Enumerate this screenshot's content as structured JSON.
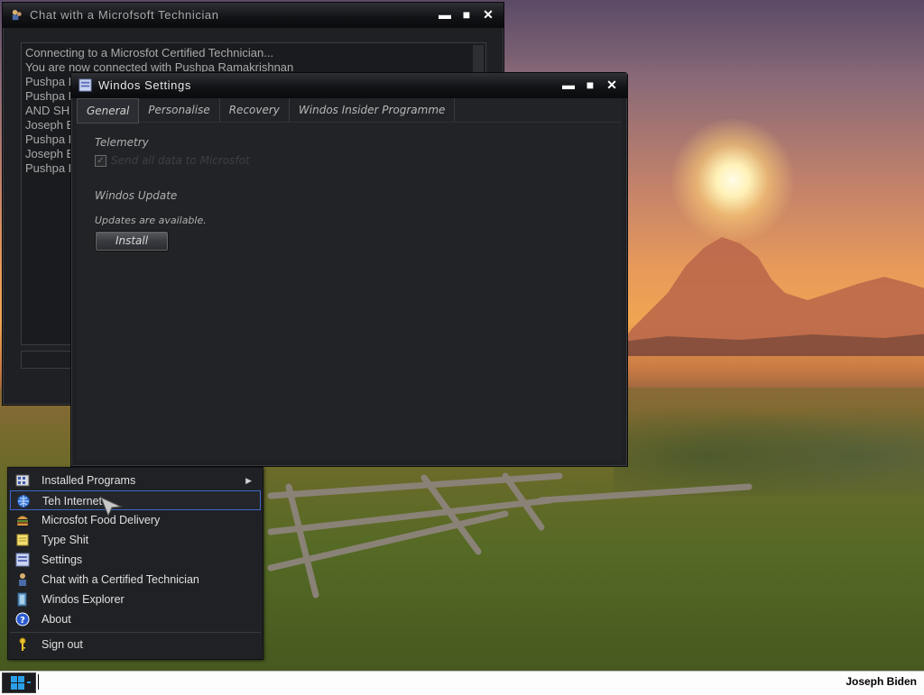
{
  "chat_window": {
    "title": "Chat with a Microfsoft Technician",
    "messages": [
      "Connecting to a Microsfot Certified Technician...",
      "You are now connected with Pushpa Ramakrishnan",
      "Pushpa R",
      "Pushpa R",
      "AND SH",
      "Joseph B",
      "Pushpa R",
      "Joseph B",
      "Pushpa R"
    ]
  },
  "settings_window": {
    "title": "Windos Settings",
    "tabs": [
      "General",
      "Personalise",
      "Recovery",
      "Windos Insider Programme"
    ],
    "active_tab": "General",
    "telemetry_label": "Telemetry",
    "telemetry_checkbox_label": "Send all data to Microsfot",
    "telemetry_checked": true,
    "update_section": "Windos Update",
    "update_status": "Updates are available.",
    "install_label": "Install"
  },
  "start_menu": {
    "items": [
      {
        "label": "Installed Programs",
        "icon": "programs-icon",
        "has_submenu": true
      },
      {
        "label": "Teh Internet",
        "icon": "internet-globe-icon",
        "highlighted": true
      },
      {
        "label": "Microsfot Food Delivery",
        "icon": "burger-icon"
      },
      {
        "label": "Type Shit",
        "icon": "notepad-icon"
      },
      {
        "label": "Settings",
        "icon": "settings-icon"
      },
      {
        "label": "Chat with a Certified Technician",
        "icon": "technician-icon"
      },
      {
        "label": "Windos Explorer",
        "icon": "explorer-icon"
      },
      {
        "label": "About",
        "icon": "help-icon"
      }
    ],
    "signout_label": "Sign out"
  },
  "taskbar": {
    "user_name": "Joseph Biden"
  },
  "colors": {
    "window_bg": "#1f2024",
    "menu_highlight_border": "#3a69c8",
    "taskbar_bg": "#fdfdfd"
  }
}
